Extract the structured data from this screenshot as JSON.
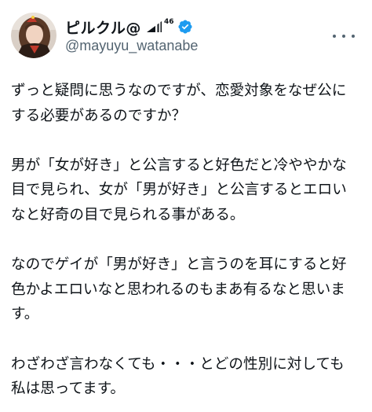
{
  "user": {
    "display_name": "ピルクル@",
    "signal_badge": "46",
    "handle": "@mayuyu_watanabe"
  },
  "icons": {
    "signal": "signal-bars-icon",
    "verified": "verified-badge-icon",
    "more": "more-options-icon"
  },
  "colors": {
    "verified": "#1d9bf0",
    "text": "#0f1419",
    "secondary": "#536471"
  },
  "tweet": {
    "paragraphs": [
      "ずっと疑問に思うなのですが、恋愛対象をなぜ公に\nする必要があるのですか？",
      "男が「女が好き」と公言すると好色だと冷ややかな\n目で見られ、女が「男が好き」と公言するとエロい\nなと好奇の目で見られる事がある。",
      "なのでゲイが「男が好き」と言うのを耳にすると好\n色かよエロいなと思われるのもまあ有るなと思いま\nす。",
      "わざわざ言わなくても・・・とどの性別に対しても\n私は思ってます。"
    ]
  }
}
